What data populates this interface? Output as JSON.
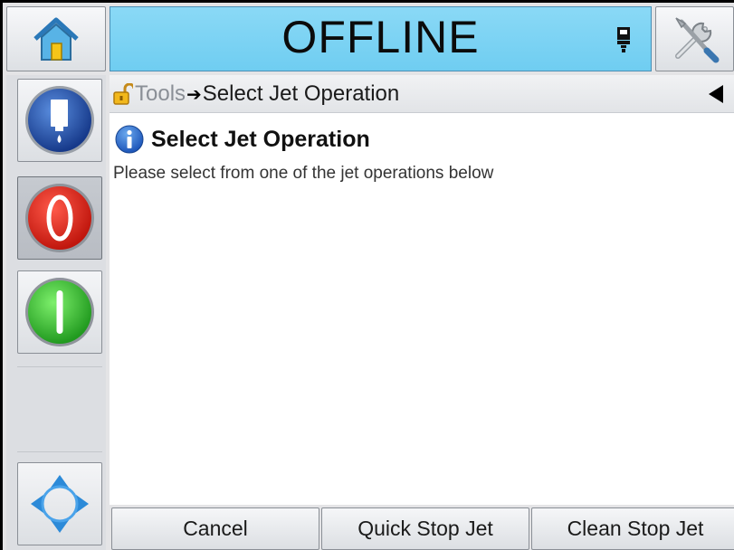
{
  "status": {
    "text": "OFFLINE"
  },
  "breadcrumb": {
    "root": "Tools",
    "separator": "➔",
    "current": "Select Jet Operation"
  },
  "content": {
    "heading": "Select Jet Operation",
    "message": "Please select from one of the jet operations below"
  },
  "buttons": {
    "cancel": "Cancel",
    "quick_stop": "Quick Stop Jet",
    "clean_stop": "Clean Stop Jet"
  },
  "colors": {
    "status_bar": "#7ad3f4",
    "stop_red": "#e5231b",
    "start_green": "#3dc43a",
    "ink_blue": "#1f4fa8",
    "nav_blue": "#2c8ad8"
  },
  "icons": {
    "home": "home-icon",
    "tools": "tools-icon",
    "printhead": "printhead-icon",
    "ink": "ink-system-icon",
    "stop": "stop-jet-icon",
    "start": "start-jet-icon",
    "nav": "navigation-icon",
    "lock": "lock-icon",
    "info": "info-icon",
    "back": "back-triangle-icon"
  }
}
